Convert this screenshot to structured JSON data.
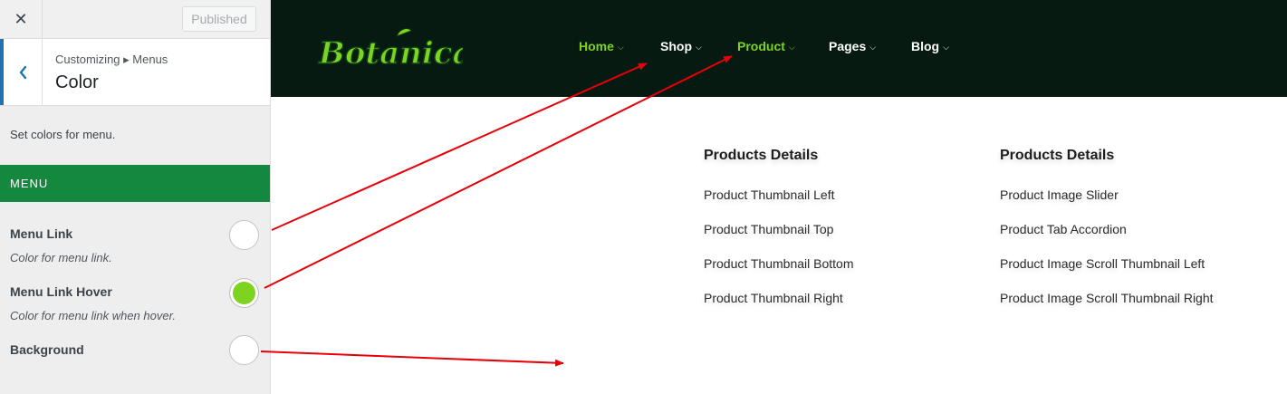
{
  "customizer": {
    "published_label": "Published",
    "breadcrumb": "Customizing ▸ Menus",
    "section_title": "Color",
    "description": "Set colors for menu.",
    "menu_heading": "MENU",
    "controls": [
      {
        "label": "Menu Link",
        "description": "Color for menu link.",
        "color": "#ffffff"
      },
      {
        "label": "Menu Link Hover",
        "description": "Color for menu link when hover.",
        "color": "#7ed321"
      },
      {
        "label": "Background",
        "description": "",
        "color": "#ffffff"
      }
    ]
  },
  "preview": {
    "logo_text": "Botanica",
    "nav": [
      {
        "label": "Home",
        "color": "#7ed321"
      },
      {
        "label": "Shop",
        "color": "#ffffff"
      },
      {
        "label": "Product",
        "color": "#7ed321"
      },
      {
        "label": "Pages",
        "color": "#ffffff"
      },
      {
        "label": "Blog",
        "color": "#ffffff"
      }
    ],
    "mega_menu": [
      {
        "heading": "Products Details",
        "links": [
          "Product Thumbnail Left",
          "Product Thumbnail Top",
          "Product Thumbnail Bottom",
          "Product Thumbnail Right"
        ]
      },
      {
        "heading": "Products Details",
        "links": [
          "Product Image Slider",
          "Product Tab Accordion",
          "Product Image Scroll Thumbnail Left",
          "Product Image Scroll Thumbnail Right"
        ]
      }
    ]
  },
  "colors": {
    "accent_green": "#14883e",
    "hover_green": "#7ed321",
    "navbar_bg": "#061a12",
    "annotation_red": "#e5000a"
  },
  "icons": {
    "close": "close-icon",
    "back": "chevron-left-icon",
    "dropdown": "chevron-down-icon"
  }
}
